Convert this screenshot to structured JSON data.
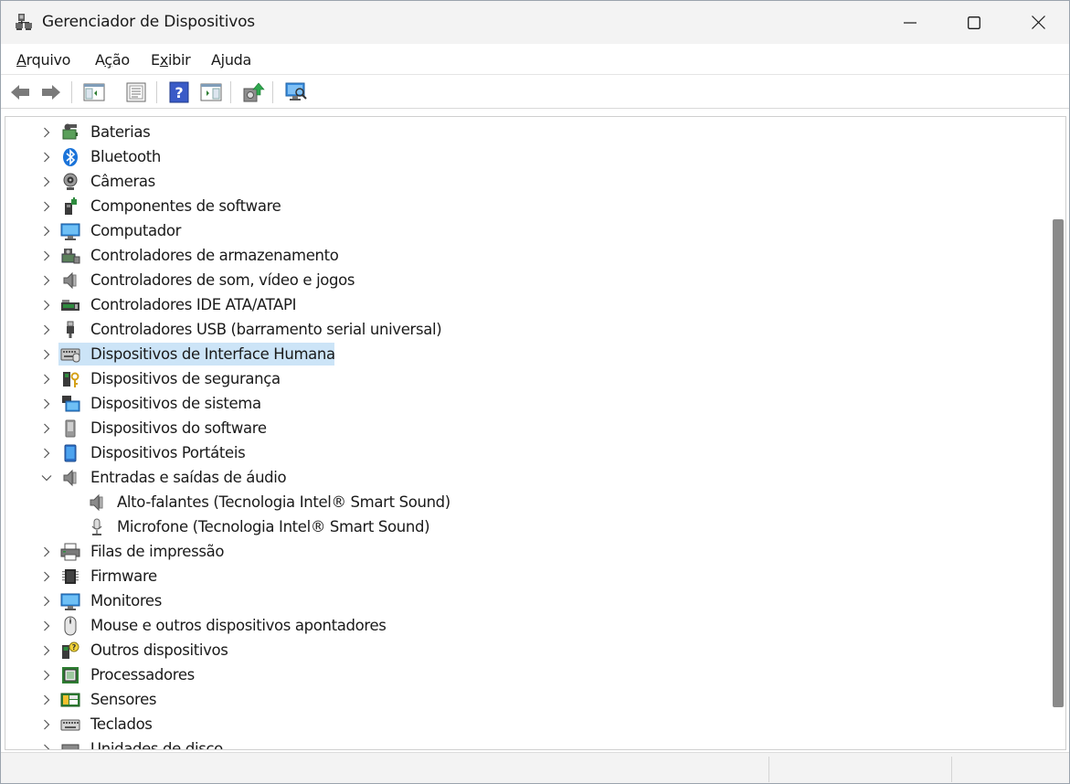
{
  "window": {
    "title": "Gerenciador de Dispositivos"
  },
  "icons": {
    "app": "device-manager-icon",
    "minimize": "minimize-icon",
    "maximize": "maximize-icon",
    "close": "close-icon"
  },
  "menu": {
    "items": [
      {
        "label": "Arquivo",
        "accel": "A",
        "rest": "rquivo"
      },
      {
        "label": "Ação",
        "accel": "ç",
        "pre": "A",
        "rest": "ão"
      },
      {
        "label": "Exibir",
        "accel": "x",
        "pre": "E",
        "rest": "ibir"
      },
      {
        "label": "Ajuda",
        "accel": "j",
        "pre": "A",
        "rest": "uda"
      }
    ]
  },
  "toolbar": {
    "buttons": [
      "back-icon",
      "forward-icon",
      "show-hide-console-tree-icon",
      "properties-icon",
      "help-icon",
      "action-pane-icon",
      "update-driver-icon",
      "scan-hardware-icon"
    ]
  },
  "tree": {
    "items": [
      {
        "label": "Baterias",
        "icon": "battery-icon",
        "expanded": false,
        "level": 0
      },
      {
        "label": "Bluetooth",
        "icon": "bluetooth-icon",
        "expanded": false,
        "level": 0
      },
      {
        "label": "Câmeras",
        "icon": "camera-icon",
        "expanded": false,
        "level": 0
      },
      {
        "label": "Componentes de software",
        "icon": "software-component-icon",
        "expanded": false,
        "level": 0
      },
      {
        "label": "Computador",
        "icon": "computer-icon",
        "expanded": false,
        "level": 0
      },
      {
        "label": "Controladores de armazenamento",
        "icon": "storage-controller-icon",
        "expanded": false,
        "level": 0
      },
      {
        "label": "Controladores de som, vídeo e jogos",
        "icon": "speaker-icon",
        "expanded": false,
        "level": 0
      },
      {
        "label": "Controladores IDE ATA/ATAPI",
        "icon": "ide-controller-icon",
        "expanded": false,
        "level": 0
      },
      {
        "label": "Controladores USB (barramento serial universal)",
        "icon": "usb-icon",
        "expanded": false,
        "level": 0
      },
      {
        "label": "Dispositivos de Interface Humana",
        "icon": "hid-icon",
        "expanded": false,
        "level": 0,
        "selected": true
      },
      {
        "label": "Dispositivos de segurança",
        "icon": "security-device-icon",
        "expanded": false,
        "level": 0
      },
      {
        "label": "Dispositivos de sistema",
        "icon": "system-device-icon",
        "expanded": false,
        "level": 0
      },
      {
        "label": "Dispositivos do software",
        "icon": "software-device-icon",
        "expanded": false,
        "level": 0
      },
      {
        "label": "Dispositivos Portáteis",
        "icon": "portable-device-icon",
        "expanded": false,
        "level": 0
      },
      {
        "label": "Entradas e saídas de áudio",
        "icon": "speaker-icon",
        "expanded": true,
        "level": 0
      },
      {
        "label": "Alto-falantes (Tecnologia Intel® Smart Sound)",
        "icon": "speaker-icon",
        "level": 1
      },
      {
        "label": "Microfone (Tecnologia Intel® Smart Sound)",
        "icon": "microphone-icon",
        "level": 1
      },
      {
        "label": "Filas de impressão",
        "icon": "printer-icon",
        "expanded": false,
        "level": 0
      },
      {
        "label": "Firmware",
        "icon": "firmware-chip-icon",
        "expanded": false,
        "level": 0
      },
      {
        "label": "Monitores",
        "icon": "monitor-icon",
        "expanded": false,
        "level": 0
      },
      {
        "label": "Mouse e outros dispositivos apontadores",
        "icon": "mouse-icon",
        "expanded": false,
        "level": 0
      },
      {
        "label": "Outros dispositivos",
        "icon": "unknown-device-icon",
        "expanded": false,
        "level": 0
      },
      {
        "label": "Processadores",
        "icon": "processor-icon",
        "expanded": false,
        "level": 0
      },
      {
        "label": "Sensores",
        "icon": "sensor-icon",
        "expanded": false,
        "level": 0
      },
      {
        "label": "Teclados",
        "icon": "keyboard-icon",
        "expanded": false,
        "level": 0
      },
      {
        "label": "Unidades de disco",
        "icon": "disk-drive-icon",
        "expanded": false,
        "level": 0
      }
    ]
  },
  "colors": {
    "selection": "#cce4f7",
    "accent": "#0078d4",
    "scrollbar_thumb": "#8a8a8a"
  }
}
